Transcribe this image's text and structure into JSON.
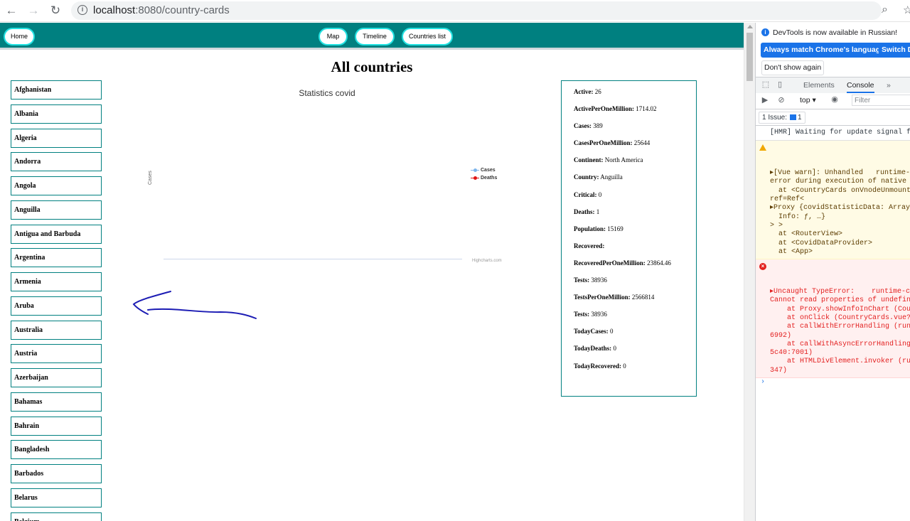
{
  "browser": {
    "url_host": "localhost",
    "url_path": ":8080/country-cards"
  },
  "nav": {
    "home": "Home",
    "map": "Map",
    "timeline": "Timeline",
    "countries_list": "Countries list"
  },
  "page_title": "All countries",
  "countries": [
    "Afghanistan",
    "Albania",
    "Algeria",
    "Andorra",
    "Angola",
    "Anguilla",
    "Antigua and Barbuda",
    "Argentina",
    "Armenia",
    "Aruba",
    "Australia",
    "Austria",
    "Azerbaijan",
    "Bahamas",
    "Bahrain",
    "Bangladesh",
    "Barbados",
    "Belarus",
    "Belgium"
  ],
  "chart": {
    "title": "Statistics covid",
    "ylabel": "Cases",
    "legend": [
      {
        "name": "Cases",
        "color": "#7cb5ec"
      },
      {
        "name": "Deaths",
        "color": "#e01414"
      }
    ],
    "credits": "Highcharts.com"
  },
  "chart_data": {
    "type": "line",
    "title": "Statistics covid",
    "ylabel": "Cases",
    "series": [
      {
        "name": "Cases",
        "values": []
      },
      {
        "name": "Deaths",
        "values": []
      }
    ],
    "legend": "right"
  },
  "info": [
    {
      "key": "Active:",
      "value": " 26"
    },
    {
      "key": "ActivePerOneMillion:",
      "value": " 1714.02"
    },
    {
      "key": "Cases:",
      "value": " 389"
    },
    {
      "key": "CasesPerOneMillion:",
      "value": " 25644"
    },
    {
      "key": "Continent:",
      "value": " North America"
    },
    {
      "key": "Country:",
      "value": " Anguilla"
    },
    {
      "key": "Critical:",
      "value": " 0"
    },
    {
      "key": "Deaths:",
      "value": " 1"
    },
    {
      "key": "Population:",
      "value": " 15169"
    },
    {
      "key": "Recovered:",
      "value": ""
    },
    {
      "key": "RecoveredPerOneMillion:",
      "value": " 23864.46"
    },
    {
      "key": "Tests:",
      "value": " 38936"
    },
    {
      "key": "TestsPerOneMillion:",
      "value": " 2566814"
    },
    {
      "key": "Tests:",
      "value": " 38936"
    },
    {
      "key": "TodayCases:",
      "value": " 0"
    },
    {
      "key": "TodayDeaths:",
      "value": " 0"
    },
    {
      "key": "TodayRecovered:",
      "value": " 0"
    }
  ],
  "devtools": {
    "notice": "DevTools is now available in Russian!",
    "match_btn": "Always match Chrome's language",
    "switch_btn": "Switch D",
    "dont_show": "Don't show again",
    "tab_elements": "Elements",
    "tab_console": "Console",
    "more_tabs": "»",
    "context": "top ▾",
    "filter_placeholder": "Filter",
    "issues": "1 Issue:",
    "issues_count": "1",
    "console_lines": {
      "hmr": "[HMR] Waiting for update signal fro",
      "warn": [
        "▸[Vue warn]: Unhandled   runtime-co",
        "error during execution of native ev",
        "  at <CountryCards onVnodeUnmounted",
        "ref=Ref<",
        "▸Proxy {covidStatisticData: Array(",
        "  Info: ƒ, …}",
        "> >",
        "  at <RouterView>",
        "  at <CovidDataProvider>",
        "  at <App>"
      ],
      "error": [
        "▸Uncaught TypeError:    runtime-co",
        "Cannot read properties of undefined",
        "    at Proxy.showInfoInChart (Count",
        "    at onClick (CountryCards.vue?fc",
        "    at callWithErrorHandling (runti",
        "6992)",
        "    at callWithAsyncErrorHandling (",
        "5c40:7001)",
        "    at HTMLDivElement.invoker (runt",
        "347)"
      ]
    }
  }
}
